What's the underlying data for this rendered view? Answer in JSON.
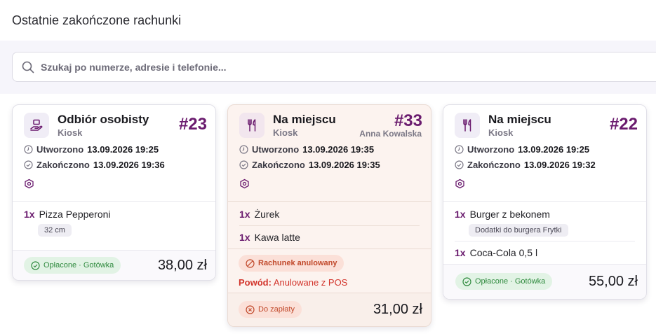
{
  "page": {
    "title": "Ostatnie zakończone rachunki"
  },
  "search": {
    "placeholder": "Szukaj po numerze, adresie i telefonie..."
  },
  "labels": {
    "created": "Utworzono",
    "finished": "Zakończono",
    "reason_label": "Powód:"
  },
  "currency_colors": {
    "accent": "#6a1b6e",
    "paid": "#2f8a3e",
    "cancelled": "#c1492b"
  },
  "orders": [
    {
      "type": "Odbiór osobisty",
      "type_icon": "takeaway-hand-icon",
      "source": "Kiosk",
      "number": "#23",
      "created": "13.09.2026 19:25",
      "finished": "13.09.2026 19:36",
      "items": [
        {
          "qty": "1x",
          "name": "Pizza Pepperoni",
          "modifier": "32 cm"
        }
      ],
      "status": "Opłacone · Gotówka",
      "total": "38,00 zł"
    },
    {
      "type": "Na miejscu",
      "type_icon": "fork-knife-icon",
      "source": "Kiosk",
      "number": "#33",
      "staff": "Anna Kowalska",
      "created": "13.09.2026 19:35",
      "finished": "13.09.2026 19:35",
      "items": [
        {
          "qty": "1x",
          "name": "Żurek"
        },
        {
          "qty": "1x",
          "name": "Kawa latte"
        }
      ],
      "cancel_label": "Rachunek anulowany",
      "cancel_reason": "Anulowane z POS",
      "status": "Do zapłaty",
      "total": "31,00 zł"
    },
    {
      "type": "Na miejscu",
      "type_icon": "fork-knife-icon",
      "source": "Kiosk",
      "number": "#22",
      "created": "13.09.2026 19:25",
      "finished": "13.09.2026 19:32",
      "items": [
        {
          "qty": "1x",
          "name": "Burger z bekonem",
          "modifier": "Dodatki do burgera Frytki"
        },
        {
          "qty": "1x",
          "name": "Coca-Cola 0,5 l"
        }
      ],
      "status": "Opłacone · Gotówka",
      "total": "55,00 zł"
    }
  ]
}
